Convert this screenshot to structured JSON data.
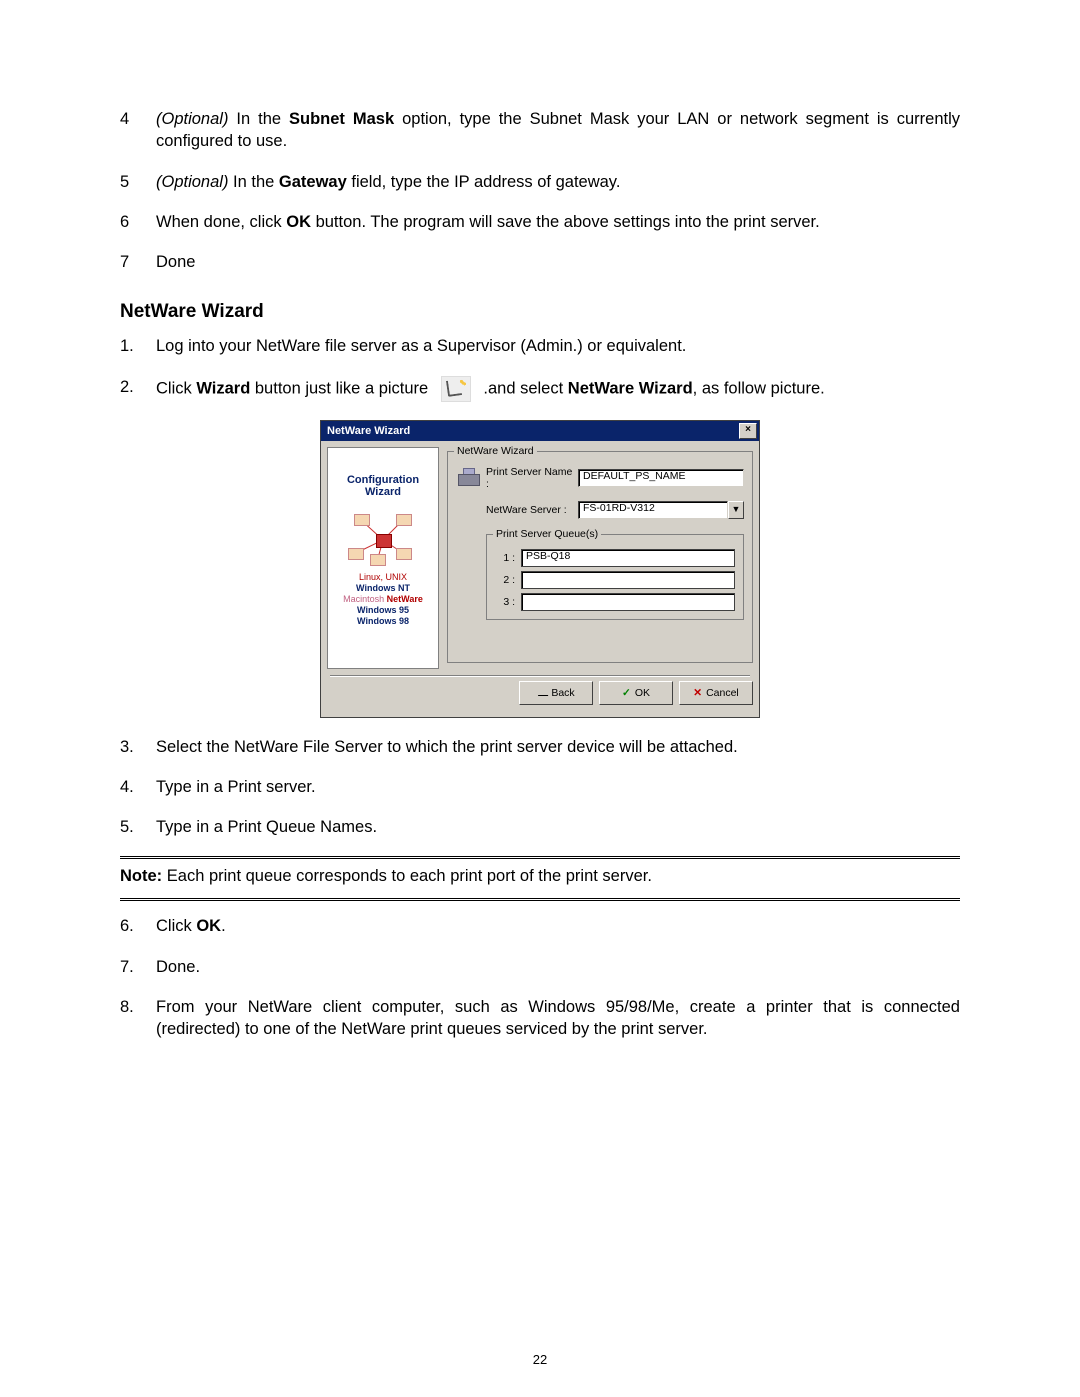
{
  "steps_a": [
    {
      "num": "4",
      "prefix_i": "(Optional) ",
      "prefix_plain": "In the ",
      "strong": "Subnet Mask",
      "rest": " option, type the Subnet Mask your LAN or network segment is currently configured to use."
    },
    {
      "num": "5",
      "prefix_i": "(Optional) ",
      "prefix_plain": "In the ",
      "strong": "Gateway",
      "rest": " field, type the IP address of gateway."
    },
    {
      "num": "6",
      "prefix_i": "",
      "prefix_plain": "When done, click ",
      "strong": "OK",
      "rest": " button. The program will save the above settings into the print server."
    },
    {
      "num": "7",
      "prefix_i": "",
      "prefix_plain": "Done",
      "strong": "",
      "rest": ""
    }
  ],
  "section_title": "NetWare Wizard",
  "steps_b1": [
    {
      "num": "1.",
      "text": "Log into your NetWare file server as a Supervisor (Admin.) or equivalent."
    }
  ],
  "step_b2": {
    "num": "2.",
    "pre": "Click ",
    "bold1": "Wizard",
    "mid1": " button just like a picture ",
    "mid2": " .and select ",
    "bold2": "NetWare Wizard",
    "post": ", as follow picture."
  },
  "dialog": {
    "title": "NetWare Wizard",
    "close": "×",
    "side": {
      "l1": "Configuration",
      "l2": "Wizard",
      "os1": "Linux, UNIX",
      "os2": "Windows NT",
      "os3a": "Macintosh",
      "os3b": " NetWare",
      "os4": "Windows 95",
      "os5": "Windows 98"
    },
    "group": "NetWare Wizard",
    "ps_label": "Print Server Name :",
    "ps_value": "DEFAULT_PS_NAME",
    "nw_label": "NetWare Server :",
    "nw_value": "FS-01RD-V312",
    "q_group": "Print Server Queue(s)",
    "q1l": "1 :",
    "q1v": "PSB-Q18",
    "q2l": "2 :",
    "q2v": "",
    "q3l": "3 :",
    "q3v": "",
    "btn_back": "Back",
    "btn_ok": "OK",
    "btn_cancel": "Cancel"
  },
  "steps_b3": [
    {
      "num": "3.",
      "text": "Select the NetWare File Server to which the print server device will be attached."
    },
    {
      "num": "4.",
      "text": "Type in a Print server."
    },
    {
      "num": "5.",
      "text": "Type in a Print Queue Names."
    }
  ],
  "note_label": "Note:",
  "note_text": " Each print queue corresponds to each print port of the print server.",
  "steps_b4": [
    {
      "num": "6.",
      "pre": "Click ",
      "strong": "OK",
      "post": "."
    },
    {
      "num": "7.",
      "pre": "Done.",
      "strong": "",
      "post": ""
    },
    {
      "num": "8.",
      "pre": "From your NetWare client computer, such as Windows 95/98/Me, create a printer that is connected (redirected) to one of the NetWare print queues serviced by the print server.",
      "strong": "",
      "post": ""
    }
  ],
  "page_number": "22"
}
